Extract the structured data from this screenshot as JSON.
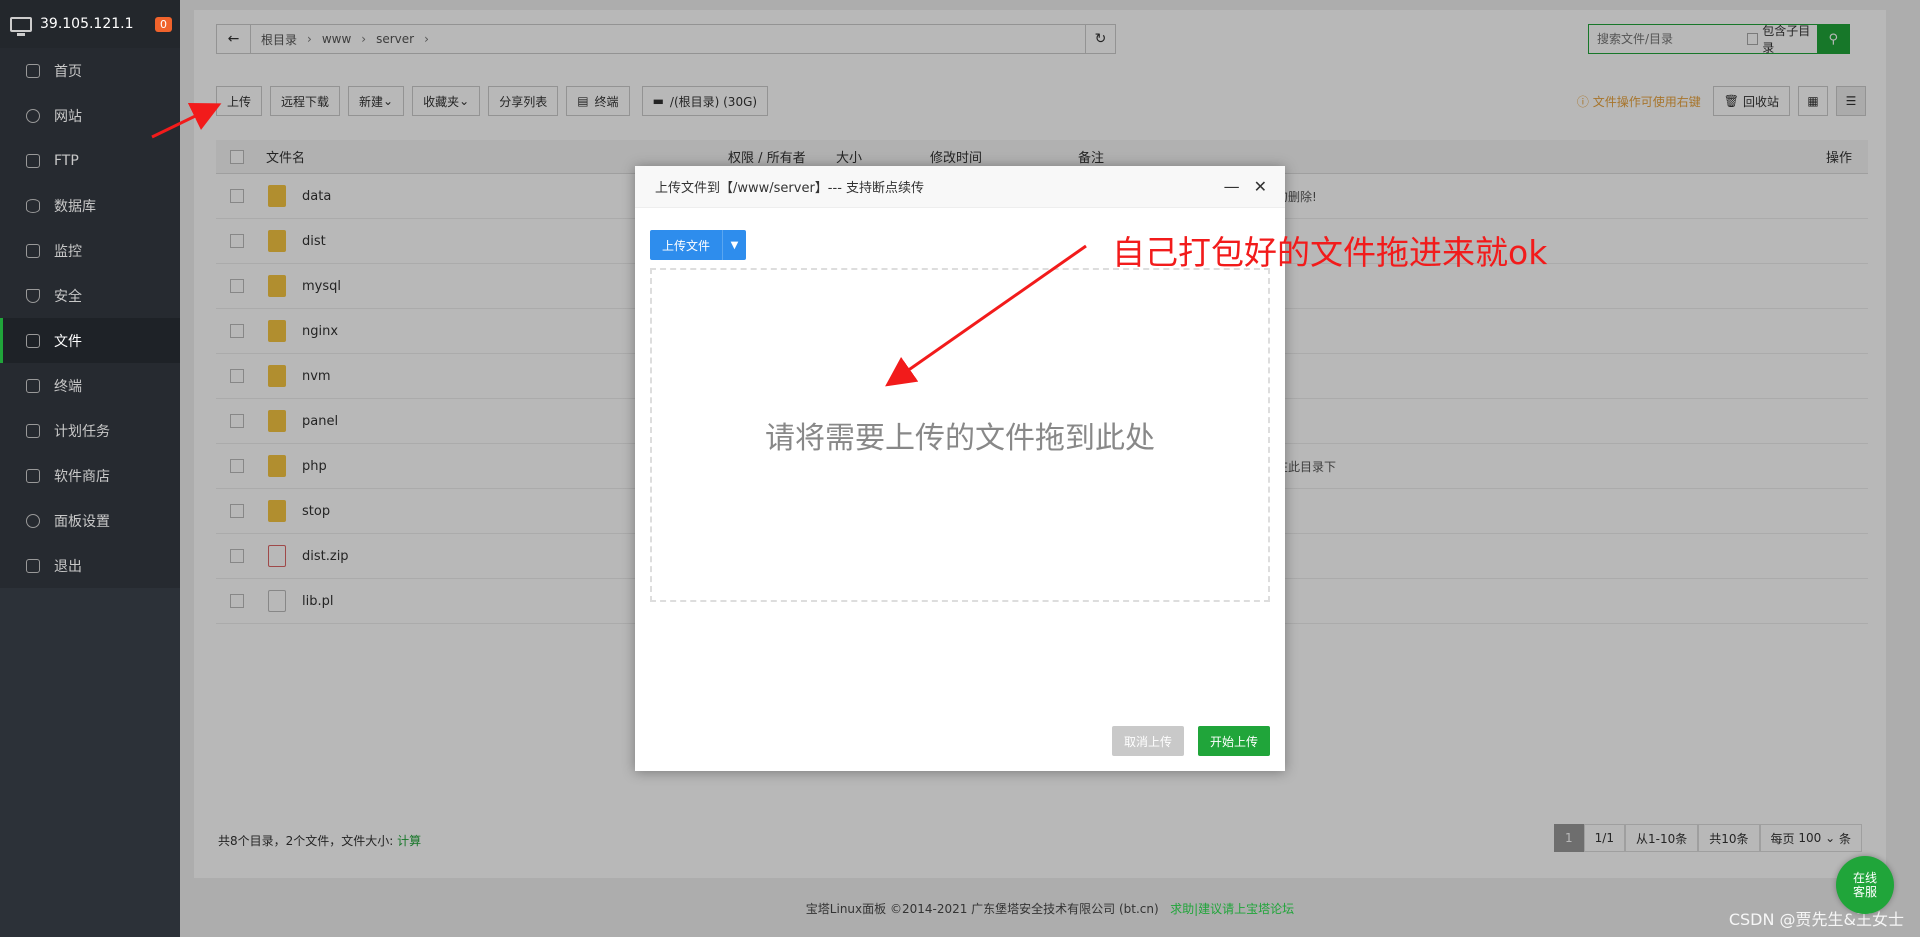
{
  "sidebar": {
    "ip": "39.105.121.1",
    "badge": "0",
    "items": [
      {
        "label": "首页"
      },
      {
        "label": "网站"
      },
      {
        "label": "FTP"
      },
      {
        "label": "数据库"
      },
      {
        "label": "监控"
      },
      {
        "label": "安全"
      },
      {
        "label": "文件"
      },
      {
        "label": "终端"
      },
      {
        "label": "计划任务"
      },
      {
        "label": "软件商店"
      },
      {
        "label": "面板设置"
      },
      {
        "label": "退出"
      }
    ]
  },
  "path": {
    "crumbs": [
      "根目录",
      "www",
      "server"
    ]
  },
  "search": {
    "placeholder": "搜索文件/目录",
    "include_sub": "包含子目录"
  },
  "toolbar": {
    "upload": "上传",
    "remote_download": "远程下载",
    "new": "新建",
    "favorites": "收藏夹",
    "share_list": "分享列表",
    "terminal": "终端",
    "disk": "/(根目录) (30G)",
    "hint": "文件操作可使用右键",
    "recycle": "回收站"
  },
  "table": {
    "headers": {
      "name": "文件名",
      "perm": "权限 / 所有者",
      "size": "大小",
      "mtime": "修改时间",
      "note": "备注",
      "ops": "操作"
    },
    "rows": [
      {
        "name": "data",
        "note": "勿删除!"
      },
      {
        "name": "dist",
        "note": ""
      },
      {
        "name": "mysql",
        "note": ""
      },
      {
        "name": "nginx",
        "note": ""
      },
      {
        "name": "nvm",
        "note": ""
      },
      {
        "name": "panel",
        "note": ""
      },
      {
        "name": "php",
        "note": "在此目录下"
      },
      {
        "name": "stop",
        "note": ""
      },
      {
        "name": "dist.zip",
        "note": ""
      },
      {
        "name": "lib.pl",
        "note": ""
      }
    ]
  },
  "footer": {
    "summary": "共8个目录，2个文件，文件大小:",
    "calc": "计算",
    "pager": {
      "current": "1",
      "pages": "1/1",
      "range": "从1-10条",
      "total": "共10条",
      "per_page_label": "每页",
      "per_page": "100",
      "unit": "条"
    }
  },
  "copyright": {
    "text": "宝塔Linux面板 ©2014-2021 广东堡塔安全技术有限公司 (bt.cn)",
    "link": "求助|建议请上宝塔论坛"
  },
  "float_service": {
    "line1": "在线",
    "line2": "客服"
  },
  "watermark": "CSDN @贾先生&王女士",
  "modal": {
    "title": "上传文件到【/www/server】--- 支持断点续传",
    "upload_btn": "上传文件",
    "drop_text": "请将需要上传的文件拖到此处",
    "cancel": "取消上传",
    "start": "开始上传"
  },
  "annotation": "自己打包好的文件拖进来就ok"
}
